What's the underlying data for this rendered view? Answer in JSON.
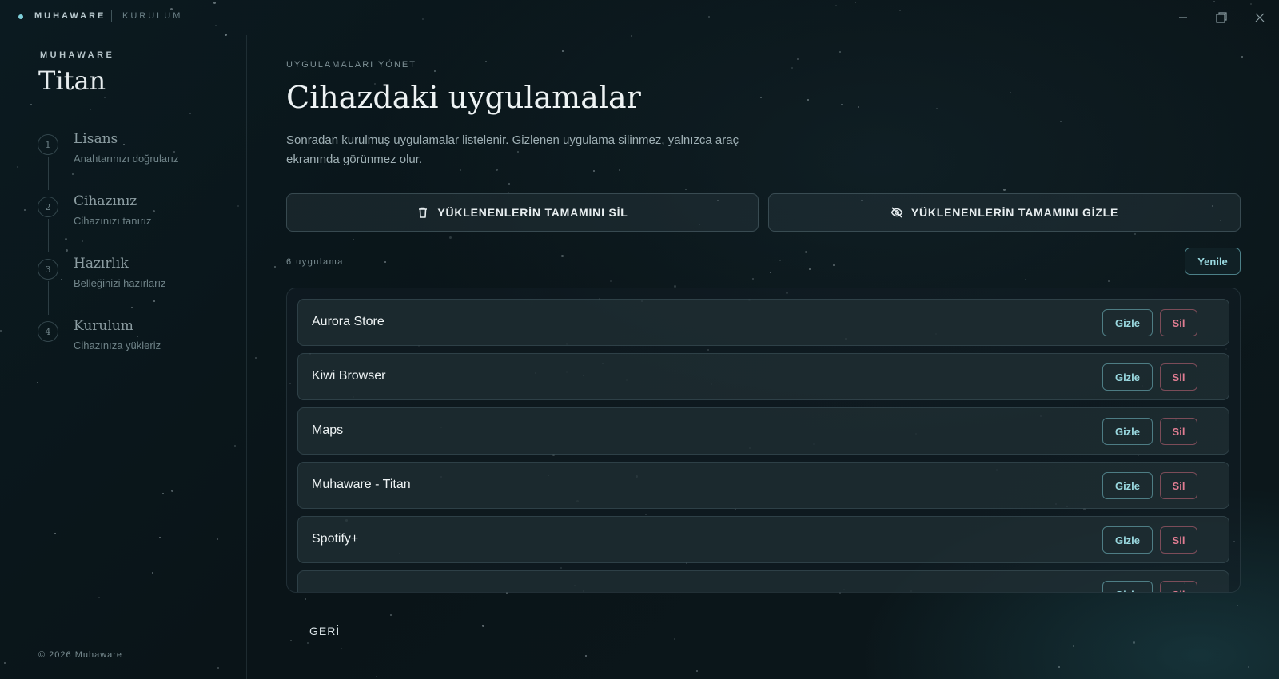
{
  "titlebar": {
    "brand": "MUHAWARE",
    "section": "KURULUM",
    "minimize_icon": "minimize-icon",
    "maximize_icon": "maximize-icon",
    "close_icon": "close-icon"
  },
  "sidebar": {
    "brand": "MUHAWARE",
    "product": "Titan",
    "steps": [
      {
        "number": "1",
        "title": "Lisans",
        "description": "Anahtarınızı doğrularız"
      },
      {
        "number": "2",
        "title": "Cihazınız",
        "description": "Cihazınızı tanırız"
      },
      {
        "number": "3",
        "title": "Hazırlık",
        "description": "Belleğinizi hazırlarız"
      },
      {
        "number": "4",
        "title": "Kurulum",
        "description": "Cihazınıza yükleriz"
      }
    ],
    "copyright": "© 2026 Muhaware"
  },
  "main": {
    "eyebrow": "UYGULAMALARI YÖNET",
    "title": "Cihazdaki uygulamalar",
    "description": "Sonradan kurulmuş uygulamalar listelenir. Gizlenen uygulama silinmez, yalnızca araç ekranında görünmez olur.",
    "delete_all_label": "YÜKLENENLERİN TAMAMINI SİL",
    "hide_all_label": "YÜKLENENLERİN TAMAMINI GİZLE",
    "count_label": "6 uygulama",
    "refresh_label": "Yenile",
    "hide_label": "Gizle",
    "delete_label": "Sil",
    "apps": [
      "Aurora Store",
      "Kiwi Browser",
      "Maps",
      "Muhaware - Titan",
      "Spotify+",
      ""
    ],
    "back_label": "GERİ"
  },
  "colors": {
    "accent": "#7fd0da",
    "danger": "#e07d92",
    "background": "#0a1418"
  }
}
